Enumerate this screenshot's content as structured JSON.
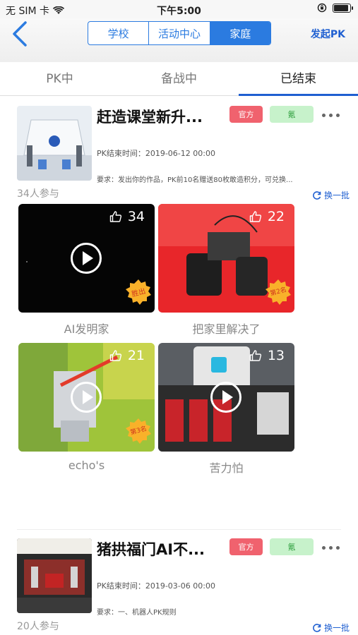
{
  "status_bar": {
    "carrier": "无 SIM 卡",
    "time": "下午5:00"
  },
  "nav": {
    "segments": [
      "学校",
      "活动中心",
      "家庭"
    ],
    "active_segment": "家庭",
    "launch_pk": "发起PK"
  },
  "tabs": [
    {
      "label": "PK中"
    },
    {
      "label": "备战中"
    },
    {
      "label": "已结束"
    }
  ],
  "active_tab": "已结束",
  "cards": [
    {
      "title": "赶造课堂新升...",
      "badge_official": "官方",
      "badge_type": "氪",
      "end_time": "PK结束时间：2019-06-12 00:00",
      "requirement": "要求：发出你的作品，PK前10名赠送80枚敢造积分，可兑换...",
      "participants": "34人参与",
      "refresh": "换一批",
      "entries": [
        {
          "likes": "34",
          "name": "AI发明家",
          "rank": "胜出"
        },
        {
          "likes": "22",
          "name": "把家里解决了",
          "rank": "第2名"
        },
        {
          "likes": "21",
          "name": "echo's",
          "rank": "第3名"
        },
        {
          "likes": "13",
          "name": "苦力怕",
          "rank": ""
        }
      ]
    },
    {
      "title": "猪拱福门AI不...",
      "badge_official": "官方",
      "badge_type": "氪",
      "end_time": "PK结束时间：2019-03-06 00:00",
      "requirement": "要求：一、机器人PK规则",
      "participants": "20人参与",
      "refresh": "换一批"
    }
  ],
  "colors": {
    "accent": "#2b7be0",
    "official_badge": "#f0626e",
    "type_badge": "#c7f2cb"
  }
}
